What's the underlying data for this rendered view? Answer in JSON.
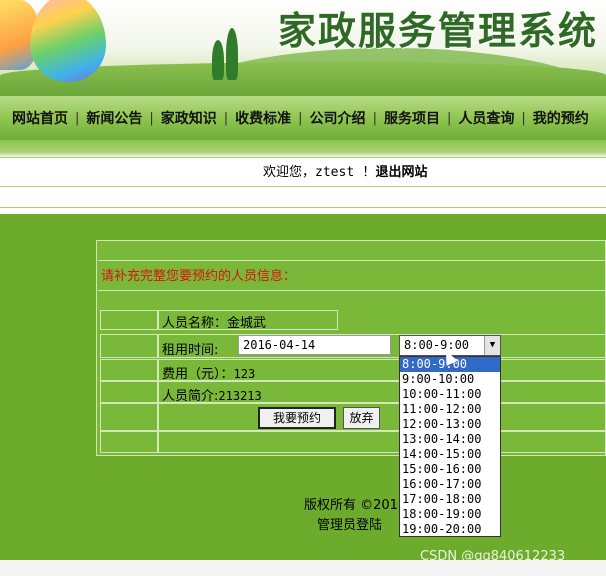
{
  "header": {
    "title": "家政服务管理系统"
  },
  "nav": {
    "items": [
      "网站首页",
      "新闻公告",
      "家政知识",
      "收费标准",
      "公司介绍",
      "服务项目",
      "人员查询",
      "我的预约"
    ]
  },
  "welcome": {
    "prefix": "欢迎您，",
    "user": "ztest",
    "bang": "！",
    "logout": "退出网站"
  },
  "form": {
    "notice": "请补充完整您要预约的人员信息：",
    "staff_name_label": "人员名称：",
    "staff_name": "金城武",
    "rent_time_label": "租用时间:",
    "rent_date": "2016-04-14",
    "time_selected": "8:00-9:00",
    "time_options": [
      "8:00-9:00",
      "9:00-10:00",
      "10:00-11:00",
      "11:00-12:00",
      "12:00-13:00",
      "13:00-14:00",
      "14:00-15:00",
      "15:00-16:00",
      "16:00-17:00",
      "17:00-18:00",
      "18:00-19:00",
      "19:00-20:00"
    ],
    "fee_label": "费用（元）：",
    "fee": "123",
    "intro_label": "人员简介:",
    "intro": "213213",
    "book_button": "我要预约",
    "cancel_button": "放弃"
  },
  "footer": {
    "copyright": "版权所有 ©201",
    "admin_login": "管理员登陆"
  },
  "watermark": "CSDN @qq840612233"
}
